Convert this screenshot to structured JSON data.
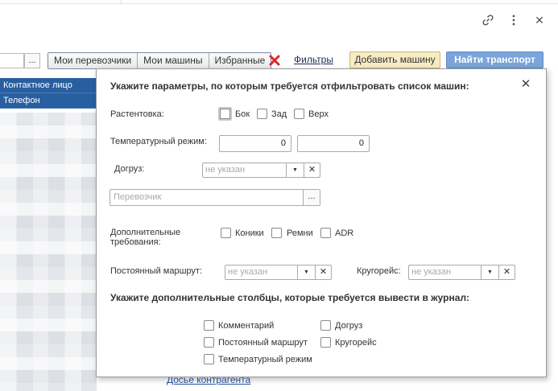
{
  "icons": {
    "link": "link-icon",
    "more": "more-vertical-icon",
    "close": "close-icon",
    "clear": "red-x-icon"
  },
  "toolbar": {
    "left_dots": "...",
    "segments": [
      "Мои перевозчики",
      "Мои машины",
      "Избранные"
    ],
    "filters_label": "Фильтры",
    "add_label": "Добавить машину",
    "find_label": "Найти транспорт",
    "accent": "#7aa4da",
    "clear_color": "#e02525"
  },
  "grid": {
    "headers": [
      "Контактное лицо",
      "Телефон"
    ]
  },
  "background_link": "Досье контрагента",
  "popup": {
    "title": "Укажите параметры, по которым требуется отфильтровать список машин:",
    "loading": {
      "label": "Растентовка:",
      "options": [
        "Бок",
        "Зад",
        "Верх"
      ]
    },
    "temp": {
      "label": "Температурный режим:",
      "from": "0",
      "to": "0"
    },
    "reload": {
      "label": "Догруз:",
      "placeholder": "не указан"
    },
    "carrier": {
      "placeholder": "Перевозчик",
      "dots": "..."
    },
    "extra": {
      "label_line1": "Дополнительные",
      "label_line2": "требования:",
      "options": [
        "Коники",
        "Ремни",
        "ADR"
      ]
    },
    "route": {
      "label": "Постоянный маршрут:",
      "placeholder": "не указан"
    },
    "round": {
      "label": "Кругорейс:",
      "placeholder": "не указан"
    },
    "columns_title": "Укажите дополнительные столбцы, которые требуется вывести в журнал:",
    "columns": {
      "comment": "Комментарий",
      "route": "Постоянный маршрут",
      "temp": "Температурный режим",
      "reload": "Догруз",
      "round": "Кругорейс"
    }
  }
}
